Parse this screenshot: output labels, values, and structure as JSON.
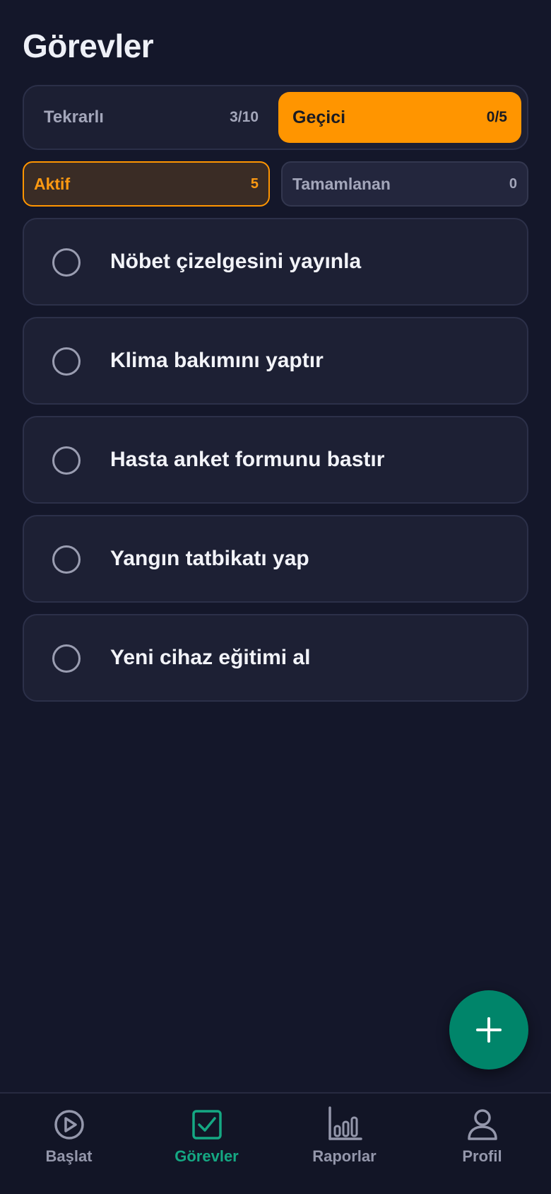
{
  "header": {
    "title": "Görevler"
  },
  "segment": {
    "tabs": [
      {
        "label": "Tekrarlı",
        "count": "3/10",
        "selected": false
      },
      {
        "label": "Geçici",
        "count": "0/5",
        "selected": true
      }
    ]
  },
  "filters": [
    {
      "label": "Aktif",
      "count": "5",
      "selected": true
    },
    {
      "label": "Tamamlanan",
      "count": "0",
      "selected": false
    }
  ],
  "tasks": [
    {
      "title": "Nöbet çizelgesini yayınla",
      "done": false
    },
    {
      "title": "Klima bakımını yaptır",
      "done": false
    },
    {
      "title": "Hasta anket formunu bastır",
      "done": false
    },
    {
      "title": "Yangın tatbikatı yap",
      "done": false
    },
    {
      "title": "Yeni cihaz eğitimi al",
      "done": false
    }
  ],
  "fab": {
    "icon": "plus-icon"
  },
  "bottom_nav": {
    "items": [
      {
        "label": "Başlat",
        "icon": "play-circle-icon",
        "selected": false
      },
      {
        "label": "Görevler",
        "icon": "checkbox-icon",
        "selected": true
      },
      {
        "label": "Raporlar",
        "icon": "bar-chart-icon",
        "selected": false
      },
      {
        "label": "Profil",
        "icon": "person-icon",
        "selected": false
      }
    ]
  },
  "colors": {
    "background": "#14172a",
    "accent_orange": "#ff9500",
    "accent_green": "#00856a",
    "nav_selected": "#15a883"
  }
}
